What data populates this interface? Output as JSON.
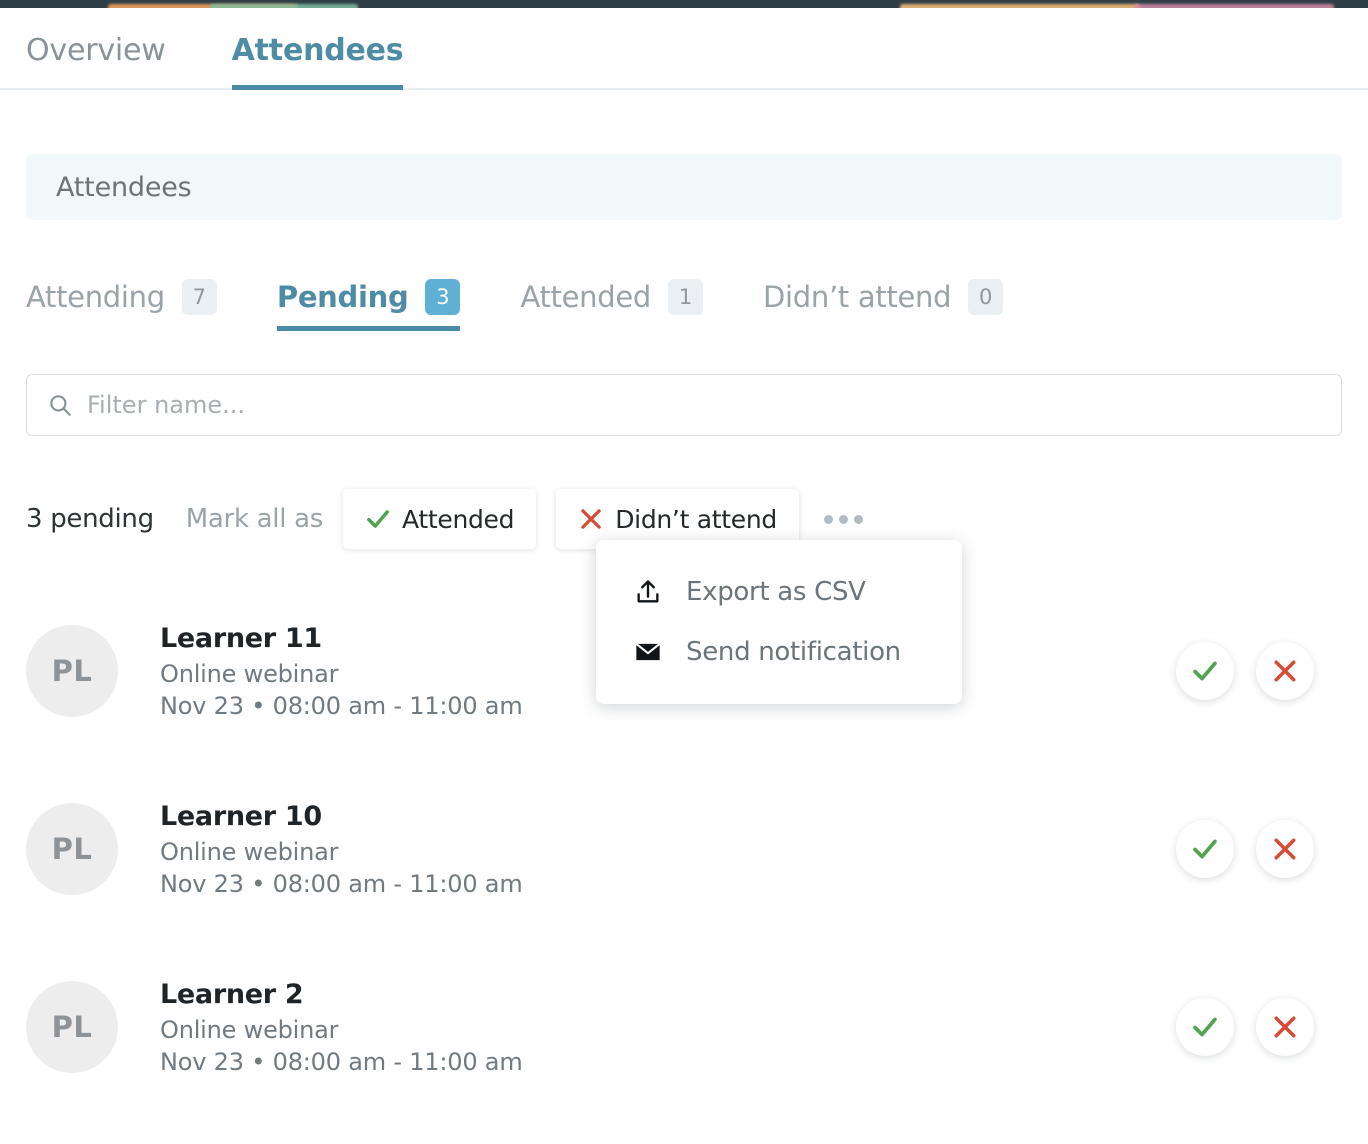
{
  "nav": {
    "tabs": [
      {
        "label": "Overview",
        "active": false
      },
      {
        "label": "Attendees",
        "active": true
      }
    ]
  },
  "banner": {
    "title": "Attendees"
  },
  "subtabs": [
    {
      "label": "Attending",
      "count": "7",
      "active": false
    },
    {
      "label": "Pending",
      "count": "3",
      "active": true
    },
    {
      "label": "Attended",
      "count": "1",
      "active": false
    },
    {
      "label": "Didn’t attend",
      "count": "0",
      "active": false
    }
  ],
  "filter": {
    "placeholder": "Filter name...",
    "value": "",
    "icon": "search-icon"
  },
  "actionbar": {
    "pending_text": "3 pending",
    "mark_all_label": "Mark all as",
    "attended_label": "Attended",
    "didnt_attend_label": "Didn’t attend",
    "more_label": "…"
  },
  "menu": {
    "items": [
      {
        "label": "Export as CSV",
        "icon": "upload-icon"
      },
      {
        "label": "Send notification",
        "icon": "envelope-icon"
      }
    ]
  },
  "attendees": [
    {
      "initials": "PL",
      "name": "Learner 11",
      "type": "Online webinar",
      "time": "Nov 23 • 08:00 am - 11:00 am"
    },
    {
      "initials": "PL",
      "name": "Learner 10",
      "type": "Online webinar",
      "time": "Nov 23 • 08:00 am - 11:00 am"
    },
    {
      "initials": "PL",
      "name": "Learner 2",
      "type": "Online webinar",
      "time": "Nov 23 • 08:00 am - 11:00 am"
    }
  ],
  "colors": {
    "accent_teal": "#4A8CA6",
    "badge_active": "#5FB0D4",
    "banner_bg": "#F1F8FA",
    "check_green": "#52A34E",
    "cross_red": "#D94A36",
    "muted_text": "#9AA3A8"
  }
}
